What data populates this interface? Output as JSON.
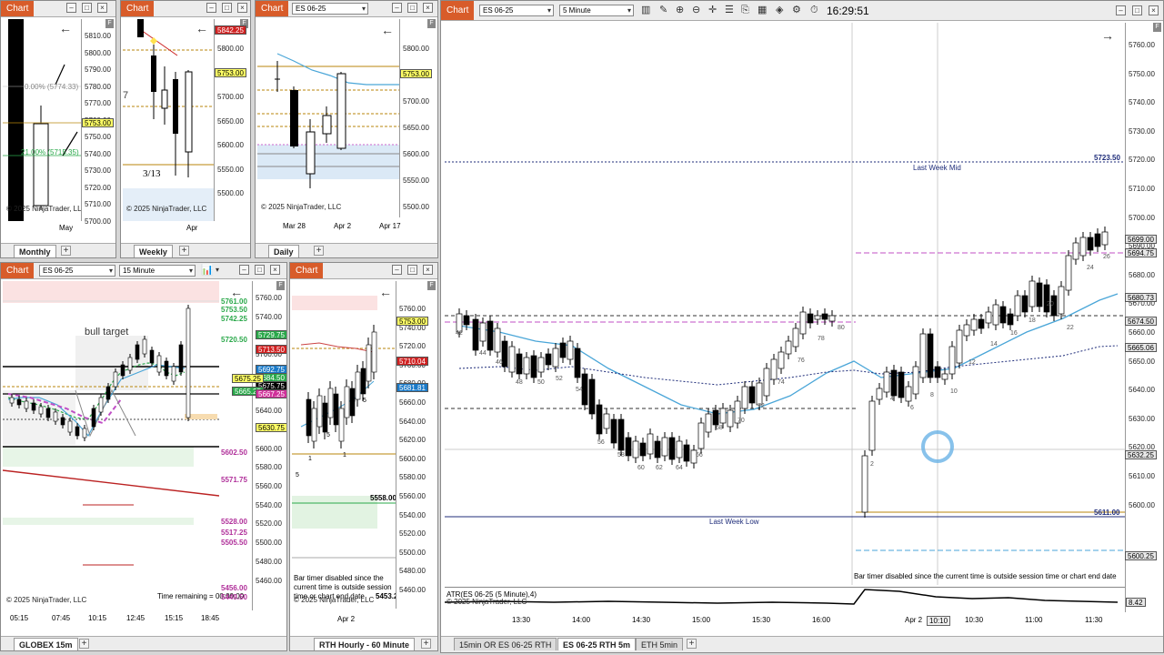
{
  "colors": {
    "accent": "#d85c2a",
    "price": "#ffff66",
    "up": "#ffffff",
    "down": "#000000",
    "ema": "#4aa6d8",
    "magenta": "#c04fc6",
    "navy": "#1f2d7a",
    "olive": "#b8860b"
  },
  "chip": "Chart",
  "monthly": {
    "tab": "Monthly",
    "ticks": [
      "5810.00",
      "5800.00",
      "5790.00",
      "5780.00",
      "5770.00",
      "5760.00",
      "5750.00",
      "5740.00",
      "5730.00",
      "5720.00",
      "5710.00",
      "5700.00"
    ],
    "price": "5753.00",
    "fib1": "0.00% (5774.33)",
    "fib2": "21.00% (5715.35)",
    "xlabel": "May",
    "copyright": "© 2025 NinjaTrader, LLC"
  },
  "weekly": {
    "tab": "Weekly",
    "ticks": [
      "5800.00",
      "5750.00",
      "5700.00",
      "5650.00",
      "5600.00",
      "5550.00",
      "5500.00"
    ],
    "price_red": "5842.25",
    "price": "5753.00",
    "date_note": "3/13",
    "xlabel": "Apr",
    "copyright": "© 2025 NinjaTrader, LLC"
  },
  "daily": {
    "tab": "Daily",
    "instrument": "ES 06-25",
    "ticks": [
      "5800.00",
      "5750.00",
      "5700.00",
      "5650.00",
      "5600.00",
      "5550.00",
      "5500.00"
    ],
    "price": "5753.00",
    "xlabels": [
      "Mar 28",
      "Apr 2",
      "Apr 17"
    ],
    "copyright": "© 2025 NinjaTrader, LLC"
  },
  "globex": {
    "tab": "GLOBEX 15m",
    "instrument": "ES 06-25",
    "interval": "15 Minute",
    "ticks": [
      "5760.00",
      "5740.00",
      "5720.00",
      "5700.00",
      "5680.00",
      "5660.00",
      "5640.00",
      "5620.00",
      "5600.00",
      "5580.00",
      "5560.00",
      "5540.00",
      "5520.00",
      "5500.00",
      "5480.00",
      "5460.00"
    ],
    "levels": [
      {
        "v": "5761.00",
        "c": "#2aa84a"
      },
      {
        "v": "5753.50",
        "c": "#2aa84a"
      },
      {
        "v": "5742.25",
        "c": "#2aa84a"
      },
      {
        "v": "5720.50",
        "c": "#2aa84a"
      },
      {
        "v": "5602.50",
        "c": "#b0309a"
      },
      {
        "v": "5571.75",
        "c": "#b0309a"
      },
      {
        "v": "5528.00",
        "c": "#b0309a"
      },
      {
        "v": "5517.25",
        "c": "#b0309a"
      },
      {
        "v": "5505.50",
        "c": "#b0309a"
      },
      {
        "v": "5456.00",
        "c": "#b0309a"
      },
      {
        "v": "5449.50",
        "c": "#b0309a"
      }
    ],
    "tags": [
      {
        "v": "5729.75",
        "bg": "#2aa84a",
        "fg": "#fff"
      },
      {
        "v": "5713.50",
        "bg": "#d02020",
        "fg": "#fff"
      },
      {
        "v": "5692.75",
        "bg": "#1a7ac8",
        "fg": "#fff"
      },
      {
        "v": "5684.50",
        "bg": "#2aa84a",
        "fg": "#fff"
      },
      {
        "v": "5675.75",
        "bg": "#000",
        "fg": "#fff"
      },
      {
        "v": "5675.25",
        "bg": "#ffff66",
        "fg": "#000"
      },
      {
        "v": "5665.25",
        "bg": "#2aa84a",
        "fg": "#fff"
      },
      {
        "v": "5667.25",
        "bg": "#d0309a",
        "fg": "#fff"
      },
      {
        "v": "5630.75",
        "bg": "#ffff66",
        "fg": "#000"
      }
    ],
    "note": "bull target",
    "time_remaining": "Time remaining = 00:00:00",
    "xlabels": [
      "05:15",
      "07:45",
      "10:15",
      "12:45",
      "15:15",
      "18:45"
    ],
    "copyright": "© 2025 NinjaTrader, LLC"
  },
  "hourly": {
    "tab": "RTH Hourly - 60 Minute",
    "ticks": [
      "5760.00",
      "5740.00",
      "5720.00",
      "5700.00",
      "5680.00",
      "5660.00",
      "5640.00",
      "5620.00",
      "5600.00",
      "5580.00",
      "5560.00",
      "5540.00",
      "5520.00",
      "5500.00",
      "5480.00",
      "5460.00"
    ],
    "price": "5753.00",
    "tag_red": "5710.04",
    "tag_blue": "5681.81",
    "level1": "5558.00",
    "level2": "5453.25",
    "bar_nums": [
      "1",
      "5",
      "1",
      "3",
      "5",
      "5"
    ],
    "timer": "Bar timer disabled since the current time is outside session time or chart end date",
    "xlabel": "Apr 2",
    "copyright": "© 2025 NinjaTrader, LLC"
  },
  "main": {
    "instrument": "ES 06-25",
    "interval": "5 Minute",
    "clock": "16:29:51",
    "tabs": [
      "15min OR ES 06-25 RTH",
      "ES 06-25 RTH 5m",
      "ETH 5min"
    ],
    "ticks": [
      "5760.00",
      "5750.00",
      "5740.00",
      "5730.00",
      "5720.00",
      "5710.00",
      "5700.00",
      "5690.00",
      "5680.00",
      "5670.00",
      "5660.00",
      "5650.00",
      "5640.00",
      "5630.00",
      "5620.00",
      "5610.00",
      "5600.00"
    ],
    "tags": [
      {
        "v": "5699.00",
        "bg": "#e8e8e8"
      },
      {
        "v": "5694.75",
        "bg": "#e8e8e8"
      },
      {
        "v": "5680.73",
        "bg": "#e8e8e8"
      },
      {
        "v": "5674.50",
        "bg": "#e8e8e8"
      },
      {
        "v": "5665.06",
        "bg": "#e8e8e8"
      },
      {
        "v": "5632.25",
        "bg": "#e8e8e8"
      },
      {
        "v": "5600.25",
        "bg": "#e8e8e8"
      }
    ],
    "last_week_mid": "Last Week Mid",
    "last_week_mid_val": "5723.50",
    "last_week_low": "Last Week Low",
    "last_week_low_val": "5611.00",
    "bar_nums": [
      "42",
      "44",
      "46",
      "48",
      "50",
      "52",
      "54",
      "56",
      "58",
      "60",
      "62",
      "64",
      "66",
      "68",
      "70",
      "72",
      "74",
      "76",
      "78",
      "80",
      "2",
      "4",
      "6",
      "8",
      "10",
      "12",
      "14",
      "16",
      "18",
      "20",
      "22",
      "24",
      "26"
    ],
    "timer": "Bar timer disabled since the current time is outside session time or chart end date",
    "atr_label": "ATR(ES 06-25 (5 Minute),4)",
    "atr_value": "8.42",
    "copyright": "© 2025 NinjaTrader, LLC",
    "xlabels": [
      "13:30",
      "14:00",
      "14:30",
      "15:00",
      "15:30",
      "16:00",
      "Apr 2",
      "10:10",
      "10:30",
      "11:00",
      "11:30"
    ]
  }
}
